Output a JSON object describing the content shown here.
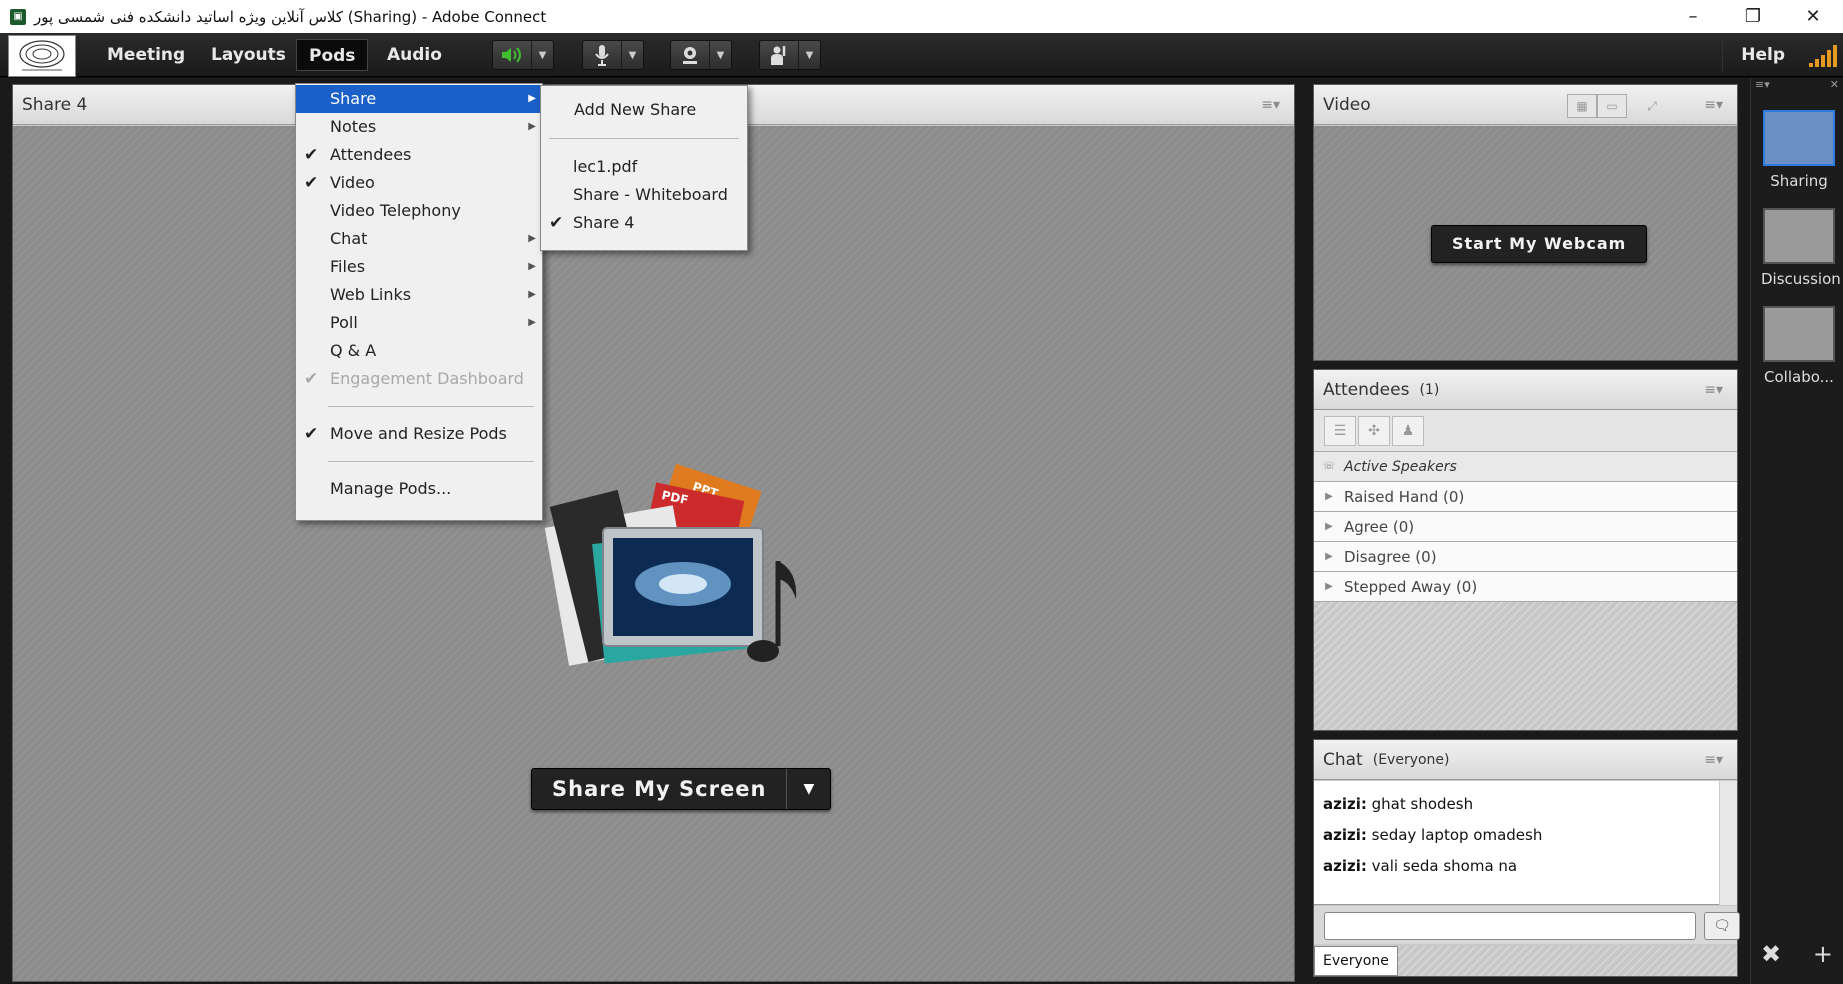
{
  "window": {
    "title": "کلاس آنلاین ویژه اساتید دانشکده فنی شمسی پور (Sharing) - Adobe Connect",
    "controls": [
      "–",
      "❐",
      "✕"
    ]
  },
  "menubar": {
    "items": [
      "Meeting",
      "Layouts",
      "Pods",
      "Audio"
    ],
    "active": "Pods",
    "help": "Help",
    "speaker_color": "#3fbf2e",
    "signal_color": "#e79a21"
  },
  "pods_menu": {
    "items": [
      {
        "label": "Share",
        "checked": false,
        "submenu": true,
        "highlighted": true
      },
      {
        "label": "Notes",
        "checked": false,
        "submenu": true
      },
      {
        "label": "Attendees",
        "checked": true,
        "submenu": false
      },
      {
        "label": "Video",
        "checked": true,
        "submenu": false
      },
      {
        "label": "Video Telephony",
        "checked": false,
        "submenu": false
      },
      {
        "label": "Chat",
        "checked": false,
        "submenu": true
      },
      {
        "label": "Files",
        "checked": false,
        "submenu": true
      },
      {
        "label": "Web Links",
        "checked": false,
        "submenu": true
      },
      {
        "label": "Poll",
        "checked": false,
        "submenu": true
      },
      {
        "label": "Q & A",
        "checked": false,
        "submenu": false
      },
      {
        "label": "Engagement Dashboard",
        "checked": true,
        "submenu": false,
        "disabled": true
      }
    ],
    "move_resize": "Move and Resize Pods",
    "manage": "Manage Pods..."
  },
  "share_submenu": {
    "add_new": "Add New Share",
    "items": [
      {
        "label": "lec1.pdf",
        "checked": false
      },
      {
        "label": "Share - Whiteboard",
        "checked": false
      },
      {
        "label": "Share 4",
        "checked": true
      }
    ]
  },
  "share_pod": {
    "title": "Share 4",
    "button": "Share My Screen",
    "graphic_labels": {
      "ppt": "PPT",
      "pdf": "PDF"
    }
  },
  "video_pod": {
    "title": "Video",
    "button": "Start My Webcam"
  },
  "attendees_pod": {
    "title": "Attendees",
    "count": "(1)",
    "active_speakers": "Active Speakers",
    "groups": [
      "Raised Hand (0)",
      "Agree (0)",
      "Disagree (0)",
      "Stepped Away (0)"
    ]
  },
  "chat_pod": {
    "title": "Chat",
    "scope": "(Everyone)",
    "messages": [
      {
        "user": "azizi:",
        "text": "ghat shodesh"
      },
      {
        "user": "azizi:",
        "text": "seday laptop omadesh"
      },
      {
        "user": "azizi:",
        "text": "vali seda shoma na"
      }
    ],
    "tab": "Everyone"
  },
  "layouts": {
    "items": [
      {
        "label": "Sharing",
        "selected": true
      },
      {
        "label": "Discussion",
        "selected": false
      },
      {
        "label": "Collabo...",
        "selected": false
      }
    ],
    "accent": "#2d7ae1"
  }
}
